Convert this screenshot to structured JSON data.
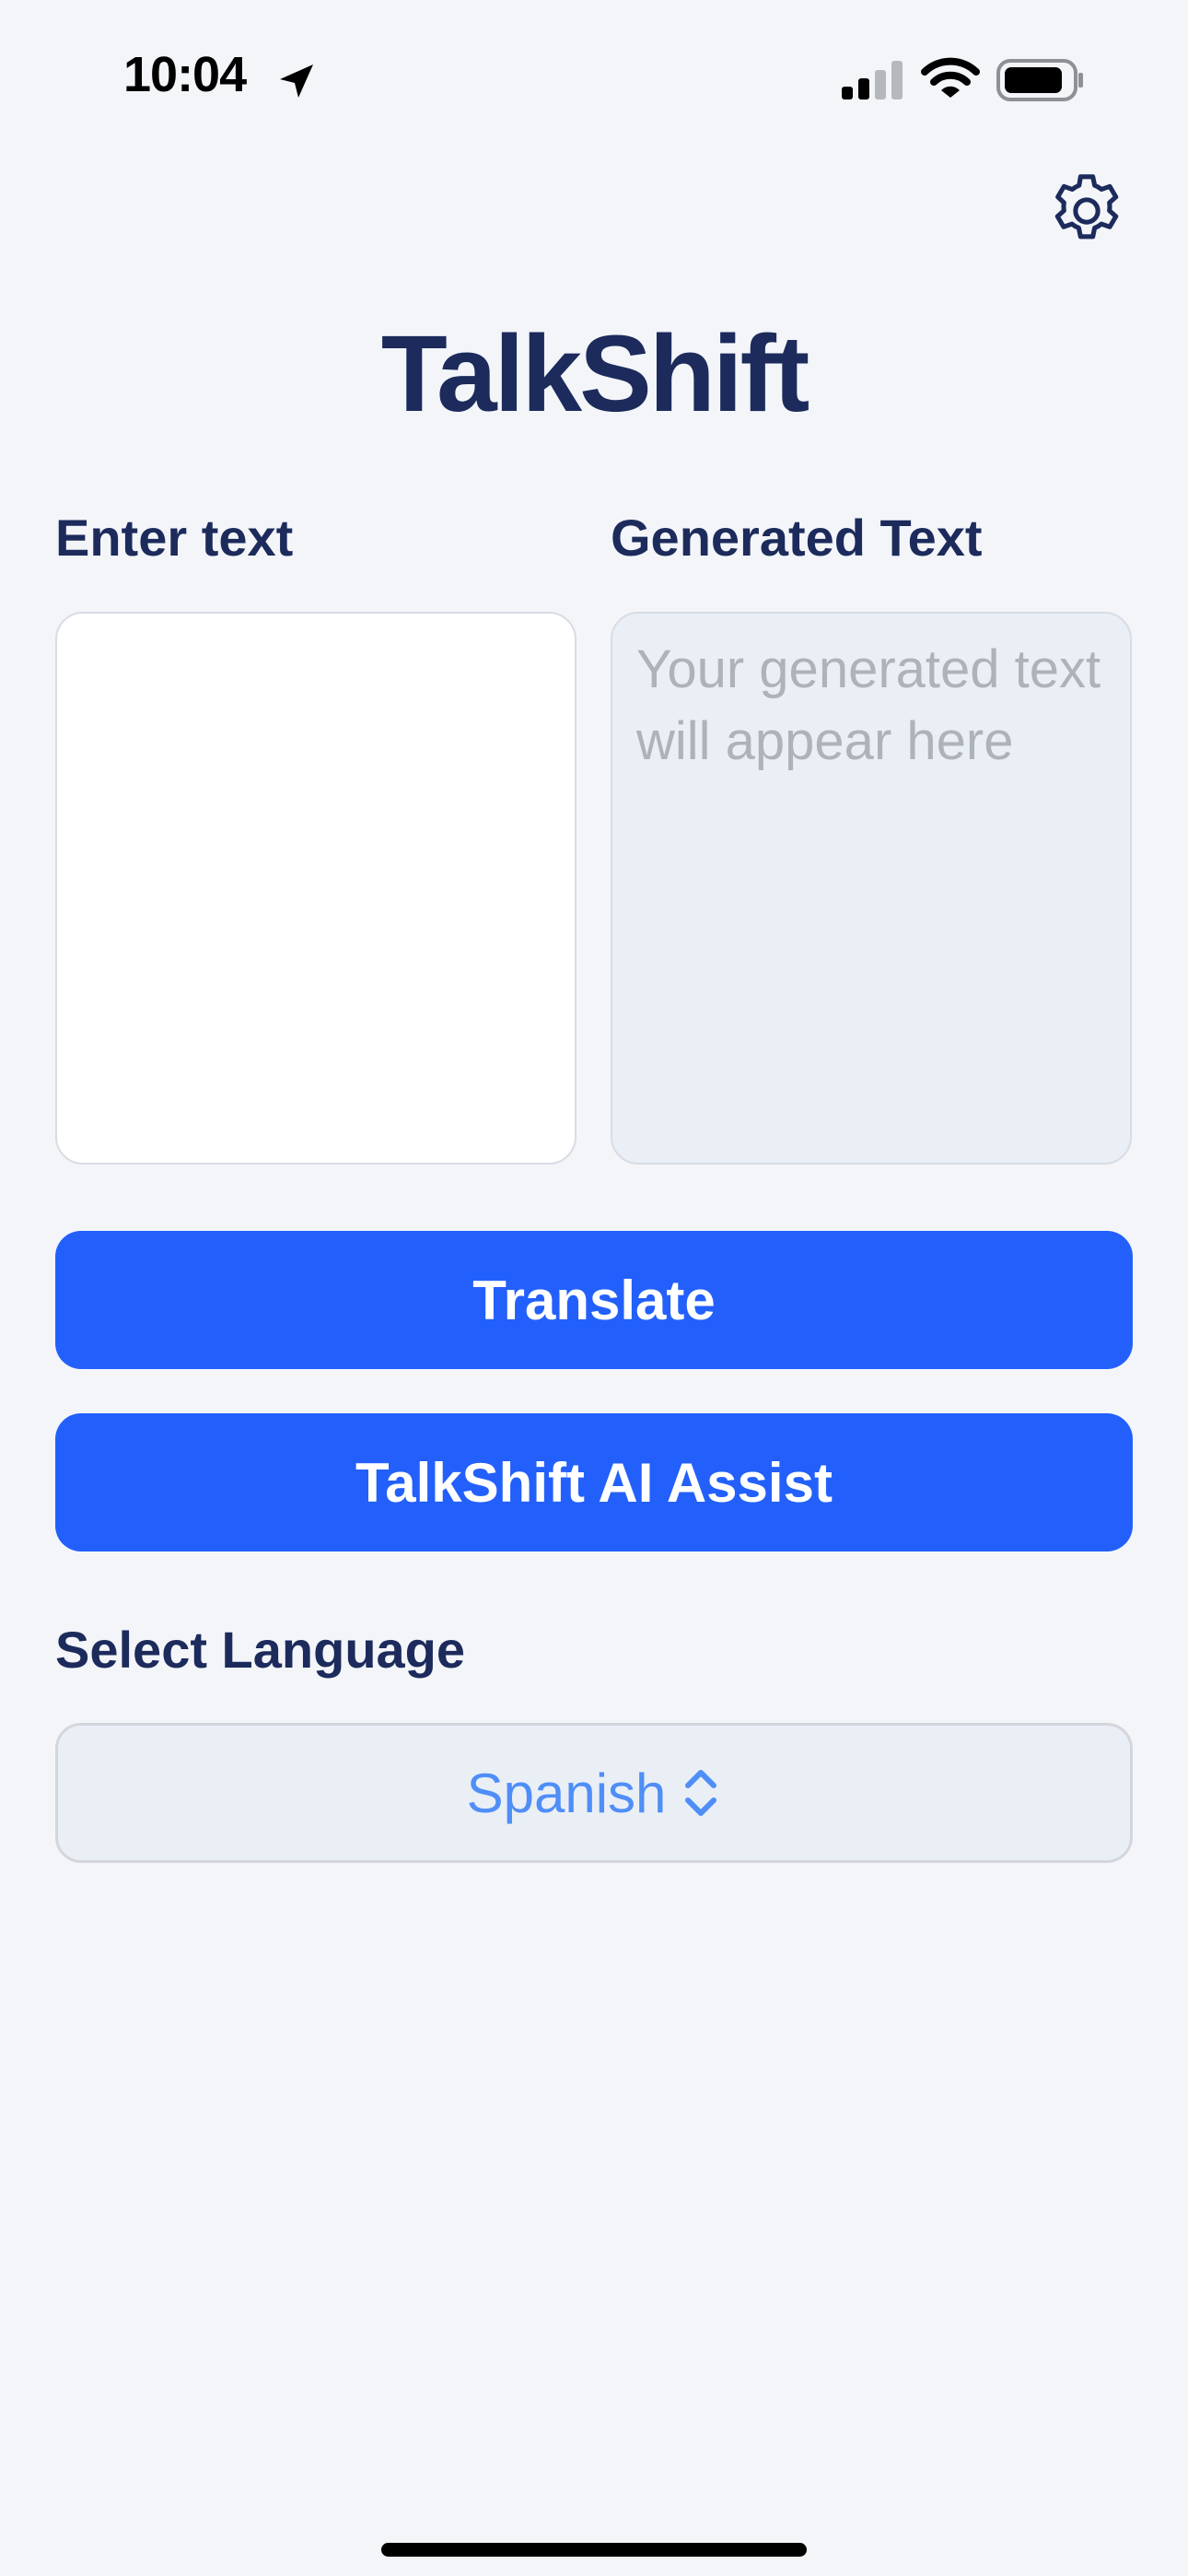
{
  "status_bar": {
    "time": "10:04",
    "icons": [
      "location-arrow-icon",
      "cellular-signal-icon",
      "wifi-icon",
      "battery-icon"
    ]
  },
  "header": {
    "settings_icon": "gear-icon",
    "title": "TalkShift"
  },
  "input_panel": {
    "label": "Enter text",
    "value": "",
    "placeholder": ""
  },
  "output_panel": {
    "label": "Generated Text",
    "placeholder": "Your generated text will appear here"
  },
  "actions": {
    "translate_label": "Translate",
    "assist_label": "TalkShift AI Assist"
  },
  "language": {
    "label": "Select Language",
    "selected": "Spanish",
    "icon": "chevron-up-down-icon"
  },
  "colors": {
    "background": "#f3f5f9",
    "title": "#1c2b5b",
    "button": "#2360fb",
    "button_text": "#ffffff",
    "language_value": "#4f8ef7",
    "placeholder": "#aeb2b9"
  }
}
